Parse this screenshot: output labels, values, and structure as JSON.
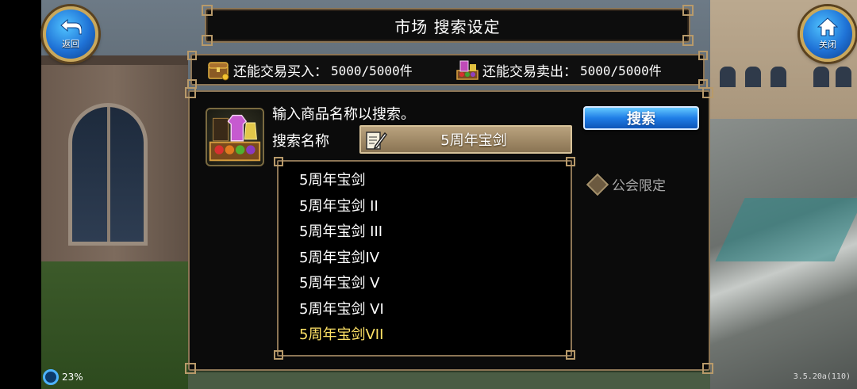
{
  "header": {
    "title": "市场  搜索设定",
    "back_label": "返回",
    "close_label": "关闭"
  },
  "quota": {
    "buy_label": "还能交易买入：",
    "buy_value": "5000/5000件",
    "sell_label": "还能交易卖出：",
    "sell_value": "5000/5000件"
  },
  "search": {
    "hint": "输入商品名称以搜索。",
    "name_label": "搜索名称",
    "name_value": "5周年宝剑",
    "button_label": "搜索",
    "guild_label": "公会限定"
  },
  "results": {
    "items": [
      {
        "label": "5周年宝剑"
      },
      {
        "label": "5周年宝剑 II"
      },
      {
        "label": "5周年宝剑 III"
      },
      {
        "label": "5周年宝剑IV"
      },
      {
        "label": "5周年宝剑 V"
      },
      {
        "label": "5周年宝剑 VI"
      },
      {
        "label": "5周年宝剑VII"
      }
    ],
    "selected_index": 6
  },
  "status": {
    "battery": "23%",
    "version": "3.5.20a(110)"
  },
  "colors": {
    "frame_gold": "#8c7555",
    "button_blue": "#1f7de6",
    "selected_text": "#ffe266"
  }
}
